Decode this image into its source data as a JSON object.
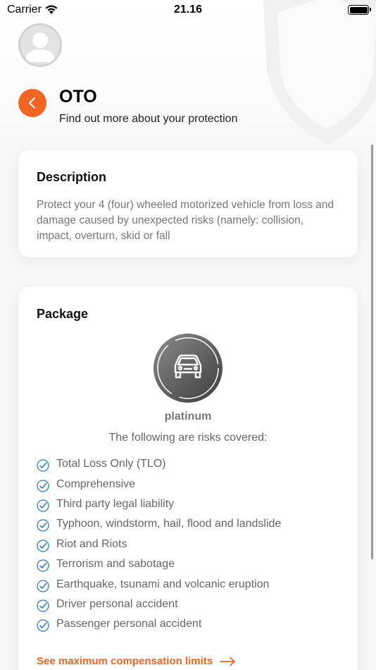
{
  "status_bar": {
    "carrier": "Carrier",
    "time": "21.16"
  },
  "header": {
    "title": "OTO",
    "subtitle": "Find out more about your protection"
  },
  "description": {
    "title": "Description",
    "text": "Protect your 4 (four) wheeled motorized vehicle from loss and damage caused by unexpected risks (namely: collision, impact, overturn, skid or fall"
  },
  "package": {
    "title": "Package",
    "icon": "car-icon",
    "name": "platinum",
    "intro": "The following are risks covered:",
    "risks": [
      "Total Loss Only (TLO)",
      "Comprehensive",
      "Third party legal liability",
      "Typhoon, windstorm, hail, flood and landslide",
      "Riot and Riots",
      "Terrorism and sabotage",
      "Earthquake, tsunami and volcanic eruption",
      "Driver personal accident",
      "Passenger personal accident"
    ],
    "limits_link": "See maximum compensation limits"
  },
  "colors": {
    "accent": "#f26522",
    "check": "#2e7bbf"
  }
}
